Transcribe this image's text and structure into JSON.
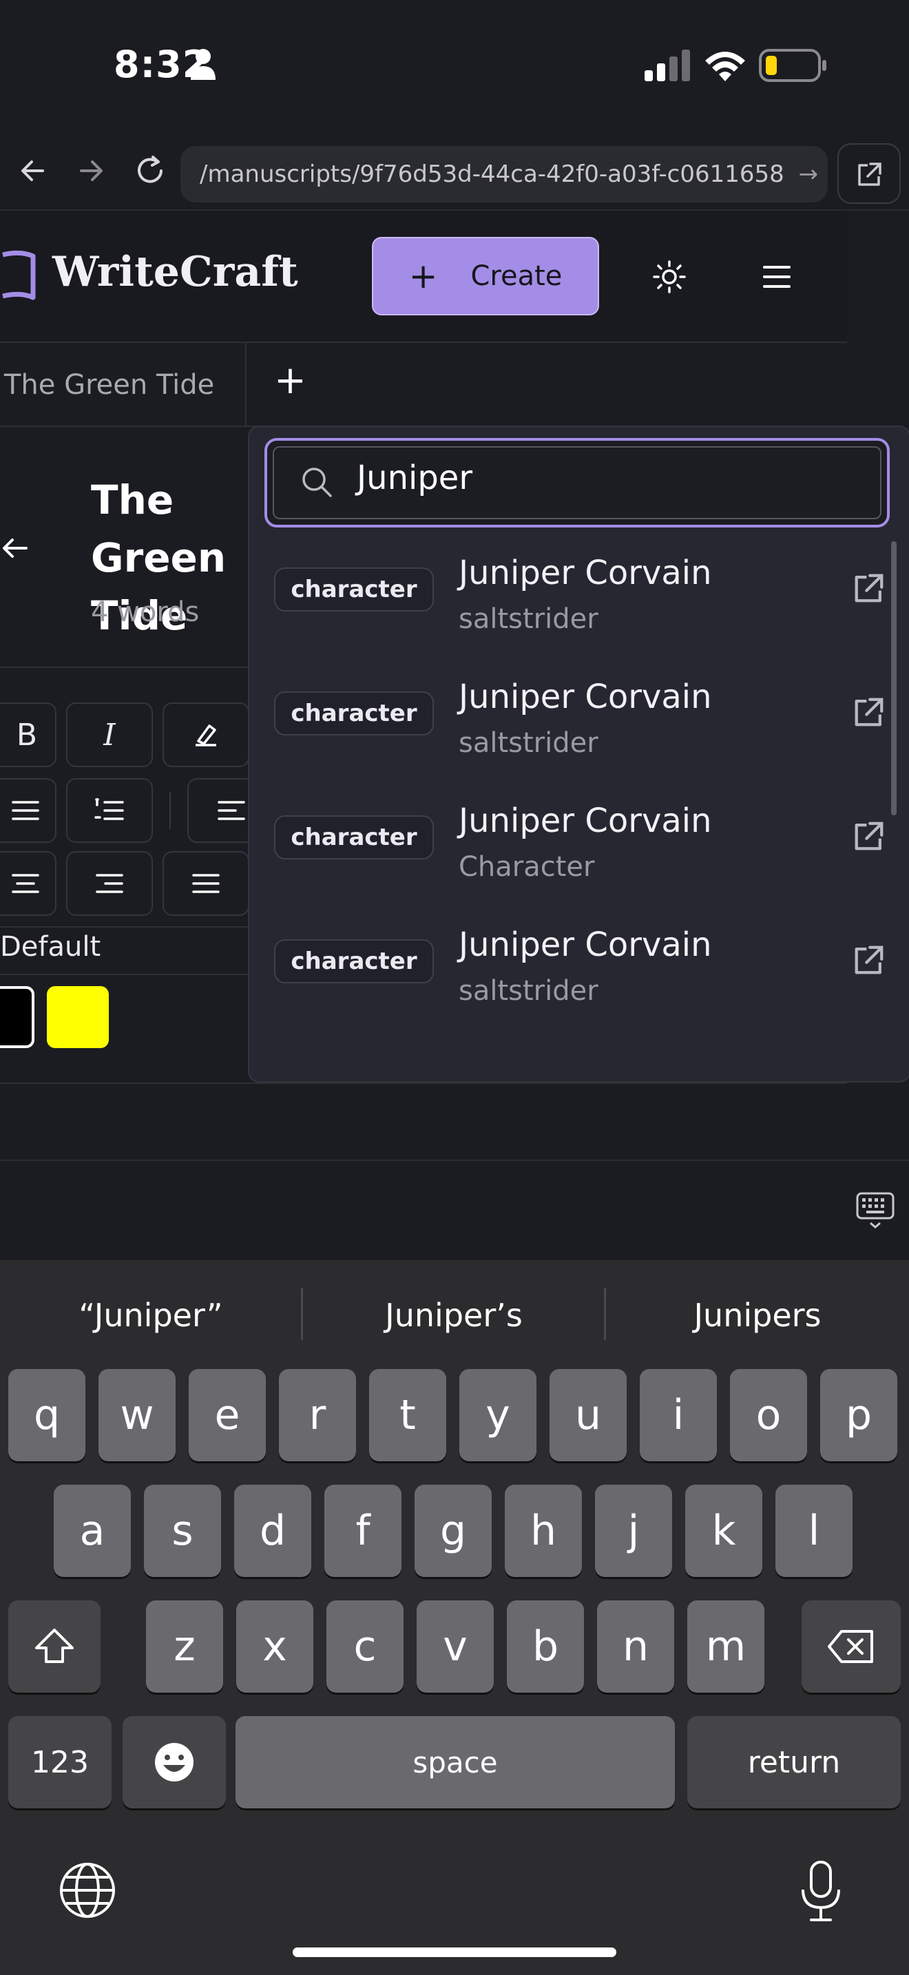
{
  "status_bar": {
    "time": "8:32"
  },
  "browser": {
    "url": "/manuscripts/9f76d53d-44ca-42f0-a03f-c0611658",
    "url_arrow": "→"
  },
  "header": {
    "brand": "WriteCraft",
    "create_label": "Create",
    "create_plus": "+"
  },
  "tabs": {
    "items": [
      {
        "label": "The Green Tide"
      }
    ],
    "add_label": "+"
  },
  "editor": {
    "title": "The Green Tide",
    "word_count": "4 words",
    "style_label": "Default",
    "toolbar": {
      "bold": "B",
      "italic": "I"
    },
    "colors": {
      "black": "#000000",
      "yellow": "#ffff00"
    }
  },
  "search": {
    "value": "Juniper",
    "results": [
      {
        "type": "character",
        "name": "Juniper Corvain",
        "subtitle": "saltstrider"
      },
      {
        "type": "character",
        "name": "Juniper Corvain",
        "subtitle": "saltstrider"
      },
      {
        "type": "character",
        "name": "Juniper Corvain",
        "subtitle": "Character"
      },
      {
        "type": "character",
        "name": "Juniper Corvain",
        "subtitle": "saltstrider"
      }
    ]
  },
  "keyboard": {
    "suggestions": [
      "“Juniper”",
      "Juniper’s",
      "Junipers"
    ],
    "row1": [
      "q",
      "w",
      "e",
      "r",
      "t",
      "y",
      "u",
      "i",
      "o",
      "p"
    ],
    "row2": [
      "a",
      "s",
      "d",
      "f",
      "g",
      "h",
      "j",
      "k",
      "l"
    ],
    "row3": [
      "z",
      "x",
      "c",
      "v",
      "b",
      "n",
      "m"
    ],
    "numbers_label": "123",
    "space_label": "space",
    "return_label": "return"
  },
  "theme": {
    "accent": "#a48de6",
    "background": "#1b1c22",
    "panel": "#262731"
  }
}
